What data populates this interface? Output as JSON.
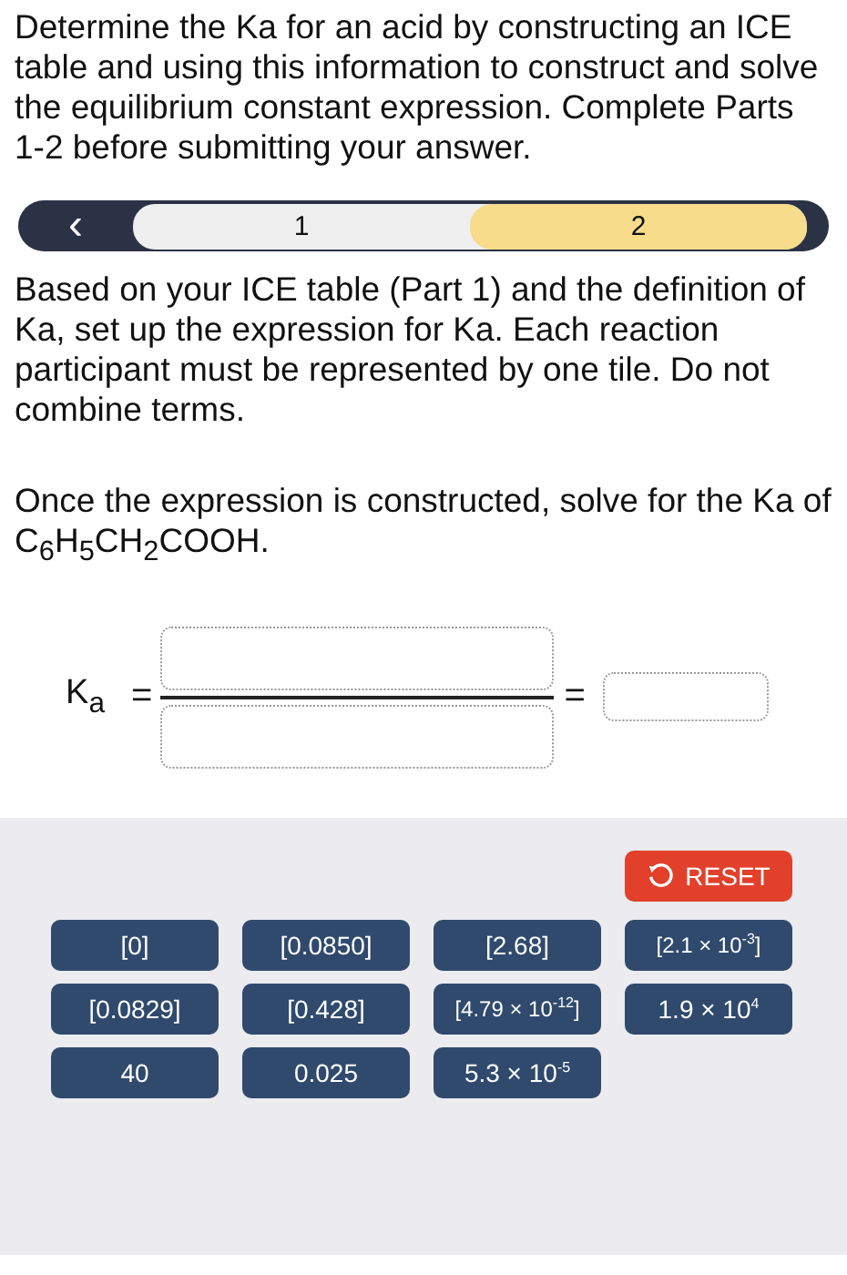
{
  "intro": "Determine the Ka for an acid by constructing an ICE table and using this information to construct and solve the equilibrium constant expression. Complete Parts 1-2 before submitting your answer.",
  "stepper": {
    "back": "‹",
    "steps": [
      {
        "label": "1",
        "selected": false
      },
      {
        "label": "2",
        "selected": true
      }
    ]
  },
  "instructions": [
    "Based on your ICE table (Part 1) and the definition of Ka, set up the expression for Ka. Each reaction participant must be represented by one tile. Do not combine terms.",
    "Once the expression is constructed, solve for the Ka of C$_{6}$H$_{5}$CH$_{2}$COOH."
  ],
  "equation": {
    "lhs": "K$_{a}$",
    "equals": [
      "=",
      "="
    ]
  },
  "reset": "RESET",
  "tiles": [
    {
      "text": "[0]"
    },
    {
      "text": "[0.0850]"
    },
    {
      "text": "[2.68]"
    },
    {
      "text": "[2.1 × 10$^{-3}$]"
    },
    {
      "text": "[0.0829]"
    },
    {
      "text": "[0.428]"
    },
    {
      "text": "[4.79 × 10$^{-12}$]"
    },
    {
      "text": "1.9 × 10$^{4}$"
    },
    {
      "text": "40"
    },
    {
      "text": "0.025"
    },
    {
      "text": "5.3 × 10$^{-5}$"
    }
  ]
}
